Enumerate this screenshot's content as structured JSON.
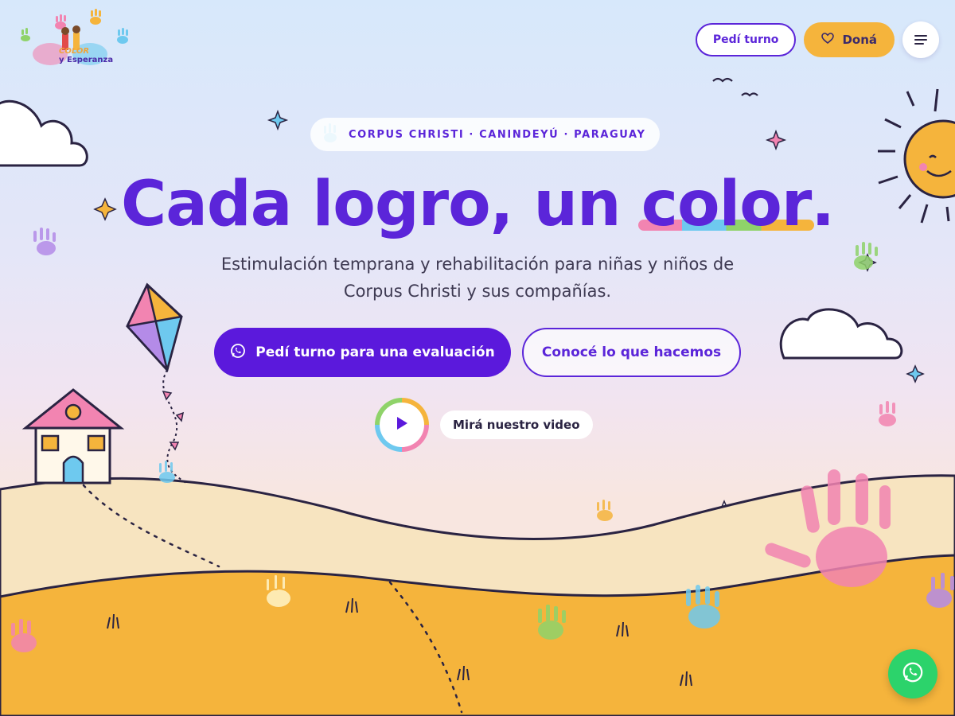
{
  "brand": {
    "logo_line1": "COLOR",
    "logo_line2": "y Esperanza"
  },
  "header": {
    "turno_label": "Pedí turno",
    "dona_label": "Doná",
    "menu_icon": "hamburger-menu-icon"
  },
  "hero": {
    "badge": "CORPUS CHRISTI · CANINDEYÚ · PARAGUAY",
    "headline_part1": "Cada logro, un ",
    "headline_highlight": "color",
    "headline_end": ".",
    "subtitle": "Estimulación temprana y rehabilitación para niñas y niños de Corpus Christi y sus compañías.",
    "cta_primary": "Pedí turno para una evaluación",
    "cta_secondary": "Conocé lo que hacemos",
    "video_label": "Mirá nuestro video"
  },
  "colors": {
    "primary": "#5b19dc",
    "accent_yellow": "#f5b43c",
    "accent_pink": "#f284b1",
    "accent_blue": "#6ec9ef",
    "accent_green": "#8fd36a",
    "whatsapp": "#2cd36b",
    "ground": "#f5b43c"
  }
}
